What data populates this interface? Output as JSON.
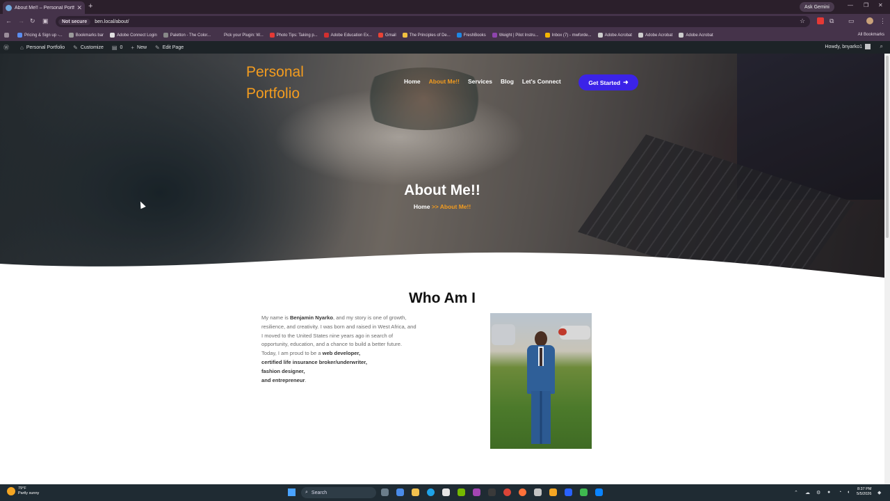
{
  "browser": {
    "tab_title": "About Me!! – Personal Portfolio",
    "ask_gemini": "Ask Gemini",
    "not_secure": "Not secure",
    "url": "ben.local/about/",
    "bookmarks": [
      {
        "label": "Pricing & Sign up -...",
        "color": "#5b8def"
      },
      {
        "label": "Bookmarks bar",
        "color": "#9a9a9a"
      },
      {
        "label": "Adobe Connect Login",
        "color": "#e0e0e0"
      },
      {
        "label": "Paletton - The Color...",
        "color": "#888888"
      },
      {
        "label": "Pick your Plugin: W...",
        "color": "#45334a"
      },
      {
        "label": "Photo Tips: Taking p...",
        "color": "#e53935"
      },
      {
        "label": "Adobe Education Ex...",
        "color": "#d32f2f"
      },
      {
        "label": "Gmail",
        "color": "#ea4335"
      },
      {
        "label": "The Principles of De...",
        "color": "#f0c040"
      },
      {
        "label": "FreshBooks",
        "color": "#1e88e5"
      },
      {
        "label": "Weight | Pilot Instru...",
        "color": "#8e44ad"
      },
      {
        "label": "Inbox (7) - mwforde...",
        "color": "#f4b400"
      },
      {
        "label": "Adobe Acrobat",
        "color": "#cccccc"
      },
      {
        "label": "Adobe Acrobat",
        "color": "#cccccc"
      },
      {
        "label": "Adobe Acrobat",
        "color": "#cccccc"
      }
    ],
    "all_bookmarks": "All Bookmarks"
  },
  "wp_admin": {
    "site": "Personal Portfolio",
    "customize": "Customize",
    "comments": "0",
    "new": "New",
    "edit_page": "Edit Page",
    "howdy": "Howdy, bnyarko1"
  },
  "site": {
    "brand_line1": "Personal",
    "brand_line2": "Portfolio",
    "nav": [
      "Home",
      "About Me!!",
      "Services",
      "Blog",
      "Let's Connect"
    ],
    "cta": "Get Started",
    "hero_title": "About Me!!",
    "crumb_home": "Home",
    "crumb_current": ">> About Me!!",
    "section_title": "Who Am I",
    "bio": {
      "p1": "My name is ",
      "name": "Benjamin Nyarko",
      "p2": ", and my story is one of growth, resilience, and creativity. I was born and raised in West Africa, and I moved to the United States nine years ago in search of opportunity, education, and a chance to build a better future. Today, I am proud to be a ",
      "role1": "web developer",
      "role2": "certified life insurance broker/underwriter",
      "role3": "fashion designer",
      "role4": "and entrepreneur"
    },
    "accent": "#f39c1f",
    "cta_color": "#3b23e8"
  },
  "taskbar": {
    "temp": "79°F",
    "weather": "Partly sunny",
    "search": "Search",
    "time": "8:37 PM",
    "date": "5/5/2026"
  }
}
